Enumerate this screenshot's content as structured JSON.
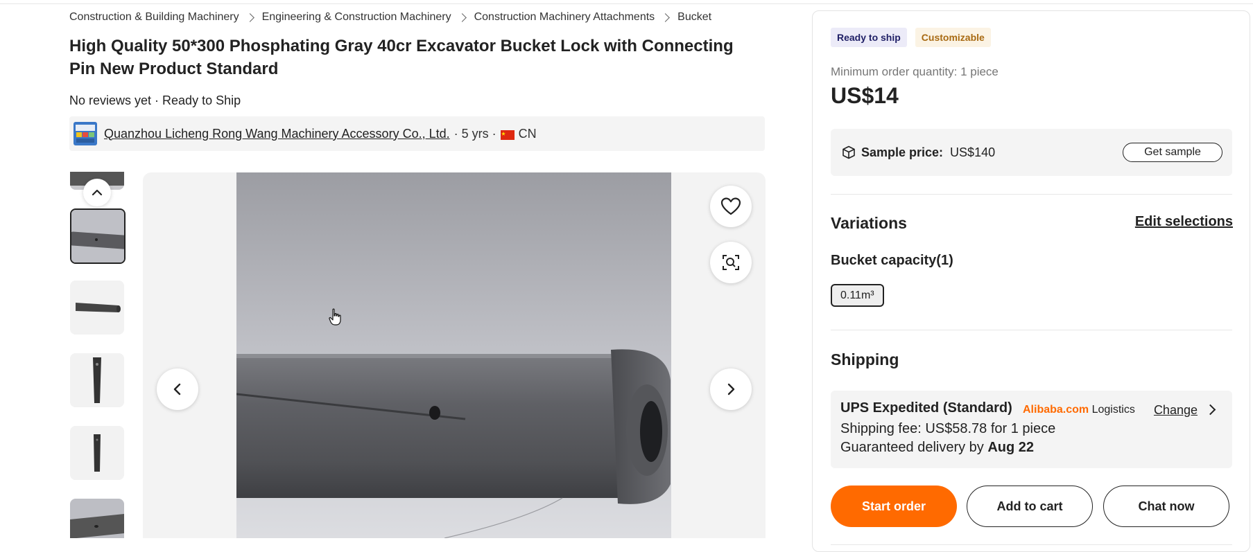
{
  "breadcrumb": [
    "Construction & Building Machinery",
    "Engineering & Construction Machinery",
    "Construction Machinery Attachments",
    "Bucket"
  ],
  "product": {
    "title": "High Quality 50*300 Phosphating Gray 40cr Excavator Bucket Lock with Connecting Pin New Product Standard",
    "reviews_line": "No reviews yet · Ready to Ship"
  },
  "supplier": {
    "name": "Quanzhou Licheng Rong Wang Machinery Accessory Co., Ltd.",
    "years": "· 5 yrs ·",
    "country": "CN"
  },
  "panel": {
    "badge_ready": "Ready to ship",
    "badge_custom": "Customizable",
    "moq": "Minimum order quantity: 1 piece",
    "price": "US$14",
    "sample_label": "Sample price:",
    "sample_value": "US$140",
    "get_sample": "Get sample",
    "variations_title": "Variations",
    "edit_selections": "Edit selections",
    "attr_label": "Bucket capacity(1)",
    "attr_option": "0.11m³",
    "shipping_title": "Shipping",
    "ship_method": "UPS Expedited (Standard)",
    "ship_brand": "Alibaba.com",
    "ship_brand_suffix": "Logistics",
    "change": "Change",
    "ship_fee": "Shipping fee: US$58.78 for 1 piece",
    "delivery_prefix": "Guaranteed delivery by",
    "delivery_date": "Aug 22",
    "start_order": "Start order",
    "add_to_cart": "Add to cart",
    "chat_now": "Chat now"
  },
  "colors": {
    "accent": "#ff6a00",
    "ready_badge_bg": "#ecebf8",
    "custom_badge_bg": "#fbf3e4",
    "custom_badge_text": "#a86a12"
  },
  "icons": [
    "chevron-up-icon",
    "chevron-left-icon",
    "chevron-right-icon",
    "heart-icon",
    "image-search-icon",
    "box-icon",
    "cursor-hand-icon"
  ]
}
